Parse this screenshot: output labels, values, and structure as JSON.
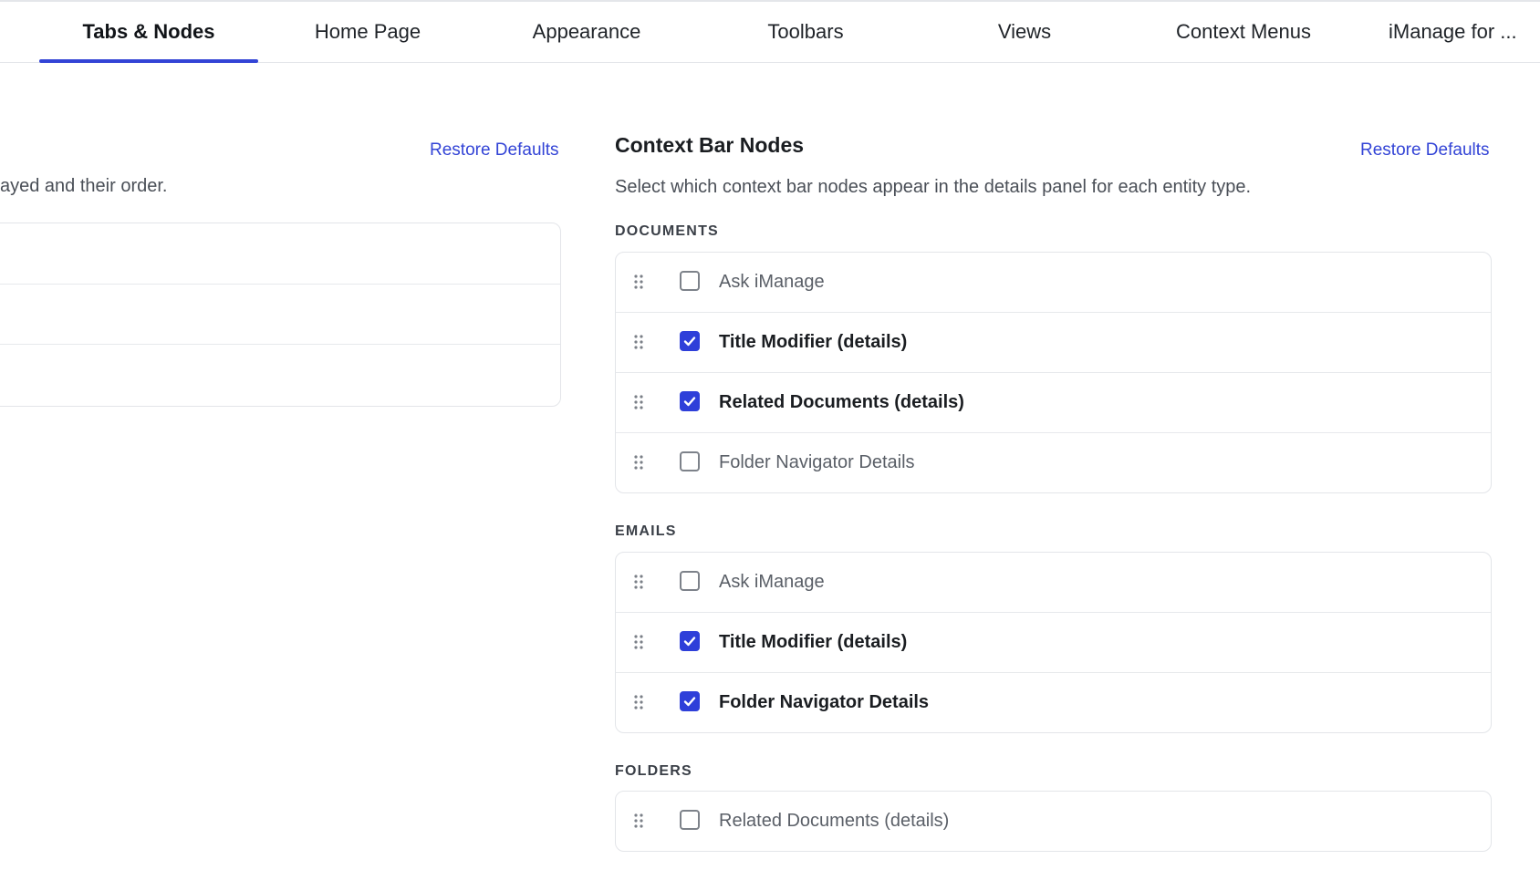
{
  "tabs": [
    {
      "label": "Tabs & Nodes",
      "active": true
    },
    {
      "label": "Home Page",
      "active": false
    },
    {
      "label": "Appearance",
      "active": false
    },
    {
      "label": "Toolbars",
      "active": false
    },
    {
      "label": "Views",
      "active": false
    },
    {
      "label": "Context Menus",
      "active": false
    },
    {
      "label": "iManage for ...",
      "active": false
    }
  ],
  "left_panel": {
    "restore_label": "Restore Defaults",
    "description": "ayed and their order."
  },
  "context_bar": {
    "title": "Context Bar Nodes",
    "restore_label": "Restore Defaults",
    "description": "Select which context bar nodes appear in the details panel for each entity type.",
    "sections": [
      {
        "label": "DOCUMENTS",
        "items": [
          {
            "label": "Ask iManage",
            "checked": false
          },
          {
            "label": "Title Modifier (details)",
            "checked": true
          },
          {
            "label": "Related Documents (details)",
            "checked": true
          },
          {
            "label": "Folder Navigator Details",
            "checked": false
          }
        ]
      },
      {
        "label": "EMAILS",
        "items": [
          {
            "label": "Ask iManage",
            "checked": false
          },
          {
            "label": "Title Modifier (details)",
            "checked": true
          },
          {
            "label": "Folder Navigator Details",
            "checked": true
          }
        ]
      },
      {
        "label": "FOLDERS",
        "items": [
          {
            "label": "Related Documents (details)",
            "checked": false
          }
        ]
      }
    ]
  },
  "colors": {
    "accent": "#2e3fd9",
    "link": "#3344d6",
    "border": "#e3e5e9"
  }
}
